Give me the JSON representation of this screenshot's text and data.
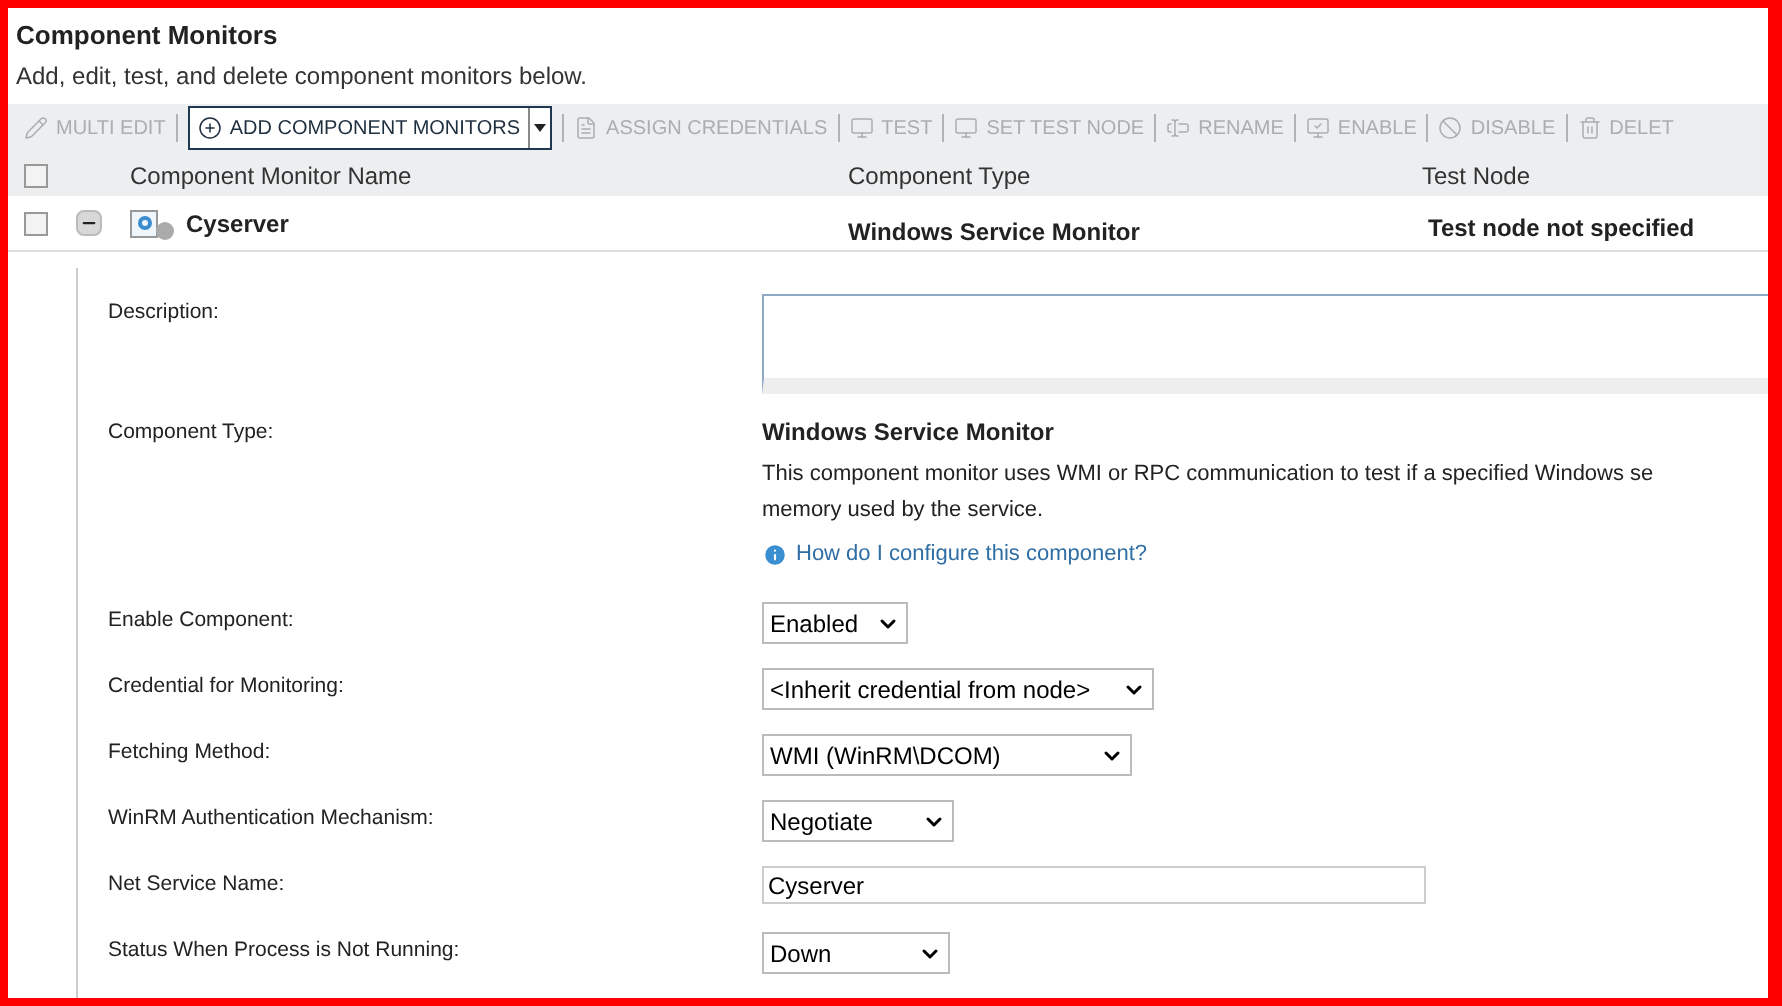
{
  "header": {
    "title": "Component Monitors",
    "subtitle": "Add, edit, test, and delete component monitors below."
  },
  "toolbar": [
    {
      "label": "MULTI EDIT",
      "disabled": true,
      "kind": "button"
    },
    {
      "label": "ADD COMPONENT MONITORS",
      "disabled": false,
      "kind": "split"
    },
    {
      "label": "ASSIGN CREDENTIALS",
      "disabled": true,
      "kind": "button"
    },
    {
      "label": "TEST",
      "disabled": true,
      "kind": "button"
    },
    {
      "label": "SET TEST NODE",
      "disabled": true,
      "kind": "button"
    },
    {
      "label": "RENAME",
      "disabled": true,
      "kind": "button"
    },
    {
      "label": "ENABLE",
      "disabled": true,
      "kind": "button"
    },
    {
      "label": "DISABLE",
      "disabled": true,
      "kind": "button"
    },
    {
      "label": "DELET",
      "disabled": true,
      "kind": "button"
    }
  ],
  "table": {
    "select_all_checked": false,
    "columns": [
      "Component Monitor Name",
      "Component Type",
      "Test Node"
    ],
    "rows": [
      {
        "checked": false,
        "expanded": true,
        "name": "Cyserver",
        "type": "Windows Service Monitor",
        "test_node": "Test node not specified"
      }
    ]
  },
  "details": [
    {
      "kind": "textarea",
      "label": "Description:"
    },
    {
      "kind": "info",
      "label": "Component Type:",
      "title": "Windows Service Monitor",
      "description": "This component monitor uses WMI or RPC communication to test if a specified Windows se",
      "description_2": "memory used by the service.",
      "link": "How do I configure this component?"
    },
    {
      "kind": "select",
      "label": "Enable Component:",
      "value": "Enabled"
    },
    {
      "kind": "select",
      "label": "Credential for Monitoring:",
      "value": "<Inherit credential from node>"
    },
    {
      "kind": "select",
      "label": "Fetching Method:",
      "value": "WMI (WinRM\\DCOM)"
    },
    {
      "kind": "select",
      "label": "WinRM Authentication Mechanism:",
      "value": "Negotiate"
    },
    {
      "kind": "text",
      "label": "Net Service Name:",
      "value": "Cyserver"
    },
    {
      "kind": "select",
      "label": "Status When Process is Not Running:",
      "value": "Down"
    }
  ]
}
